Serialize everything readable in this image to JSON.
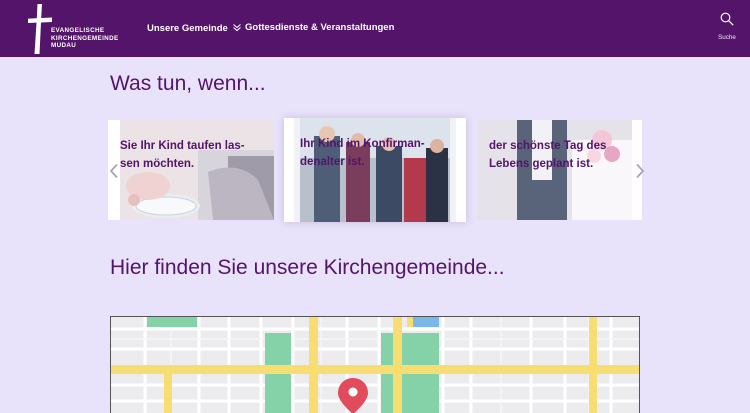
{
  "header": {
    "logo": {
      "line1": "EVANGELISCHE",
      "line2": "KIRCHENGEMEINDE",
      "line3": "MUDAU"
    },
    "nav": {
      "item1": "Unsere Gemeinde",
      "item2": "Gottesdienste & Veranstaltungen"
    },
    "search_label": "Suche"
  },
  "section1": {
    "title": "Was tun, wenn..."
  },
  "carousel": {
    "cards": [
      {
        "line1": "Sie Ihr Kind taufen las-",
        "line2": "sen möchten."
      },
      {
        "line1": "Ihr Kind im Konfirman-",
        "line2": "denalter ist."
      },
      {
        "line1": "der schönste Tag des",
        "line2": "Lebens geplant ist."
      }
    ]
  },
  "section2": {
    "title": "Hier finden Sie unsere Kirchengemeinde..."
  },
  "colors": {
    "brand": "#53146a",
    "page_bg": "#e8e2fb",
    "map_road": "#f8dd72",
    "map_park": "#86d2a8",
    "map_water": "#7bb7e8",
    "map_pin": "#e14b5b"
  },
  "icons": {
    "logo": "cross-logo-icon",
    "nav_dropdown": "chevron-down-icon",
    "search": "search-icon",
    "prev": "chevron-left-icon",
    "next": "chevron-right-icon",
    "map_pin": "map-pin-icon"
  }
}
